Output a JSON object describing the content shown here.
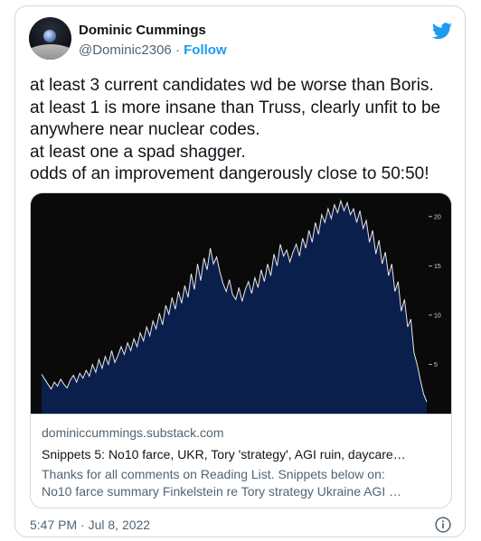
{
  "author": {
    "name": "Dominic Cummings",
    "handle": "@Dominic2306",
    "separator": "·",
    "follow_label": "Follow"
  },
  "icons": {
    "brand": "twitter-bird-icon",
    "info": "info-icon",
    "brand_color": "#1d9bf0"
  },
  "tweet": {
    "lines": [
      "at least 3 current candidates wd be worse than Boris.",
      "at least 1 is more insane than Truss, clearly unfit to be",
      "anywhere near nuclear codes.",
      "at least one a spad shagger.",
      "odds of an improvement dangerously close to 50:50!"
    ]
  },
  "link_card": {
    "domain": "dominiccummings.substack.com",
    "title": "Snippets 5: No10 farce, UKR, Tory 'strategy', AGI ruin, daycare…",
    "description_lines": [
      "Thanks for all comments on Reading List. Snippets below on:",
      "No10 farce summary Finkelstein re Tory strategy Ukraine AGI …"
    ]
  },
  "chart_data": {
    "type": "area",
    "title": "",
    "xlabel": "",
    "ylabel": "",
    "ylim": [
      0,
      22
    ],
    "y_ticks": [
      "20",
      "15",
      "10",
      "5"
    ],
    "fill_color": "#0b1f4d",
    "line_color": "#e8e8e8",
    "background": "#0a0a0a",
    "values": [
      4,
      3.5,
      3,
      2.5,
      3.2,
      2.8,
      3.5,
      3,
      2.6,
      3.4,
      3.9,
      3.2,
      4.1,
      3.6,
      4.4,
      3.8,
      5,
      4.2,
      5.5,
      4.6,
      5.8,
      5,
      6.4,
      5.2,
      5.9,
      6.8,
      6,
      7.2,
      6.4,
      7.6,
      6.8,
      8.2,
      7.4,
      8.8,
      7.9,
      9.4,
      8.6,
      10.2,
      9,
      11,
      10.1,
      11.8,
      10.6,
      12.4,
      11.2,
      13,
      11.8,
      14.2,
      12.6,
      15.2,
      13.5,
      15.8,
      14.6,
      16.8,
      15.2,
      15.9,
      14.4,
      13.2,
      12.4,
      13.6,
      12.1,
      11.6,
      12.8,
      11.4,
      12.6,
      13.4,
      12.2,
      13.8,
      12.8,
      14.6,
      13.4,
      15.2,
      14,
      16.2,
      15,
      17.2,
      16,
      16.6,
      15.4,
      16.4,
      17.2,
      16,
      17.8,
      16.8,
      18.6,
      17.4,
      19.4,
      18.2,
      20.2,
      19.4,
      20.8,
      19.8,
      21.2,
      20.4,
      21.6,
      20.6,
      21.4,
      20.2,
      20.8,
      19.4,
      20.6,
      18.8,
      19.6,
      17.4,
      18.6,
      16.2,
      17.6,
      15.2,
      16.4,
      14,
      15.2,
      12.4,
      13.4,
      10.4,
      11.6,
      8.8,
      9.6,
      6.2,
      5,
      3.4,
      2,
      1.2
    ]
  },
  "timestamp": {
    "time": "5:47 PM",
    "separator": "·",
    "date": "Jul 8, 2022"
  }
}
